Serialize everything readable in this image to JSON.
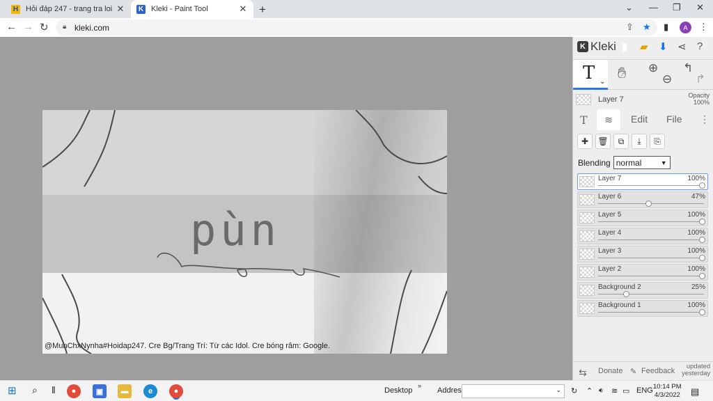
{
  "browser": {
    "tabs": [
      {
        "title": "Hỏi đáp 247 - trang tra loi",
        "favicon": "hoidap-logo-icon",
        "active": false
      },
      {
        "title": "Kleki - Paint Tool",
        "favicon": "kleki-logo-icon",
        "active": true
      }
    ],
    "url": "kleki.com"
  },
  "canvas": {
    "main_text": "pùn",
    "credit": "@MunChxNynha#Hoidap247. Cre Bg/Trang Trí: Từ các Idol. Cre bóng râm: Google."
  },
  "panel": {
    "brand": "Kleki",
    "current_layer": "Layer 7",
    "opacity_label": "Opacity",
    "opacity_value": "100%",
    "tabs": {
      "edit": "Edit",
      "file": "File"
    },
    "blending_label": "Blending",
    "blending_value": "normal",
    "layers": [
      {
        "name": "Layer 7",
        "opacity": "100%",
        "level": 1.0,
        "selected": true
      },
      {
        "name": "Layer 6",
        "opacity": "47%",
        "level": 0.47,
        "selected": false
      },
      {
        "name": "Layer 5",
        "opacity": "100%",
        "level": 1.0,
        "selected": false
      },
      {
        "name": "Layer 4",
        "opacity": "100%",
        "level": 1.0,
        "selected": false
      },
      {
        "name": "Layer 3",
        "opacity": "100%",
        "level": 1.0,
        "selected": false
      },
      {
        "name": "Layer 2",
        "opacity": "100%",
        "level": 1.0,
        "selected": false
      },
      {
        "name": "Background 2",
        "opacity": "25%",
        "level": 0.25,
        "selected": false
      },
      {
        "name": "Background 1",
        "opacity": "100%",
        "level": 1.0,
        "selected": false
      }
    ],
    "footer": {
      "donate": "Donate",
      "feedback": "Feedback",
      "updated_line1": "updated",
      "updated_line2": "yesterday"
    }
  },
  "taskbar": {
    "desktop": "Desktop",
    "address": "Address",
    "lang": "ENG",
    "time": "10:14 PM",
    "date": "4/3/2022"
  },
  "colors": {
    "accent": "#2b78e4",
    "workspace": "#9e9e9e"
  }
}
